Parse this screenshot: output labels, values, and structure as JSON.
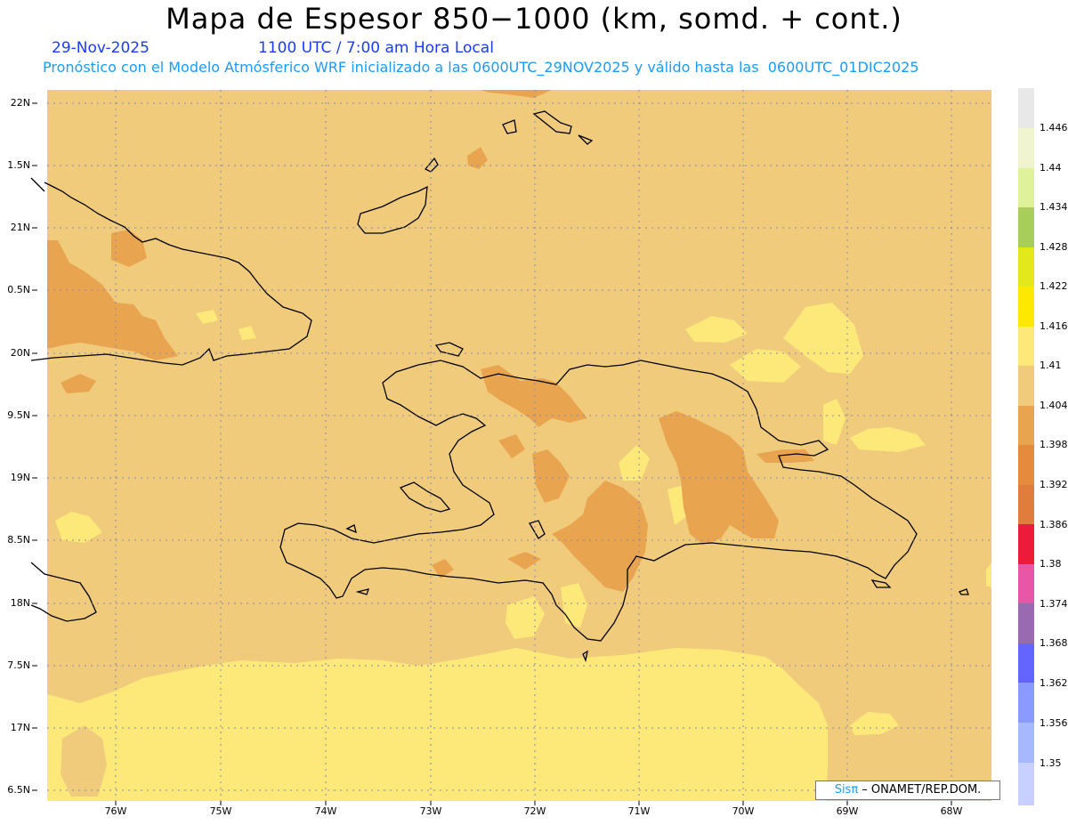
{
  "header": {
    "title": "Mapa de Espesor 850−1000 (km, somd. + cont.)",
    "date": "29-Nov-2025",
    "time": "1100 UTC / 7:00 am Hora Local",
    "description": "Pronóstico con el Modelo Atmósferico WRF inicializado a las 0600UTC_29NOV2025 y válido hasta las  0600UTC_01DIC2025"
  },
  "map": {
    "lat_labels": [
      "22N",
      "1.5N",
      "21N",
      "0.5N",
      "20N",
      "9.5N",
      "19N",
      "8.5N",
      "18N",
      "7.5N",
      "17N",
      "6.5N"
    ],
    "lon_labels": [
      "76W",
      "75W",
      "74W",
      "73W",
      "72W",
      "71W",
      "70W",
      "69W",
      "68W"
    ],
    "colors": {
      "background_field": "#f0cb7c",
      "warm_field": "#f0d28a",
      "cool_field": "#fde87a",
      "dark_field": "#e49a4c",
      "coastline": "#000000"
    }
  },
  "colorbar": {
    "levels": [
      "1.446",
      "1.44",
      "1.434",
      "1.428",
      "1.422",
      "1.416",
      "1.41",
      "1.404",
      "1.398",
      "1.392",
      "1.386",
      "1.38",
      "1.374",
      "1.368",
      "1.362",
      "1.356",
      "1.35"
    ],
    "colors": [
      "#e8e8e8",
      "#f0f5d0",
      "#dff29a",
      "#a9cd5a",
      "#e3e81a",
      "#fde800",
      "#fde87a",
      "#f0cb7c",
      "#e8a44f",
      "#e48b3e",
      "#e07c3c",
      "#ee1a3a",
      "#e856a8",
      "#9a6ab0",
      "#6464ff",
      "#8a9aff",
      "#a8b8ff",
      "#c8d0ff"
    ]
  },
  "credit": {
    "sis": "Sisπ",
    "text": " – ONAMET/REP.DOM."
  }
}
